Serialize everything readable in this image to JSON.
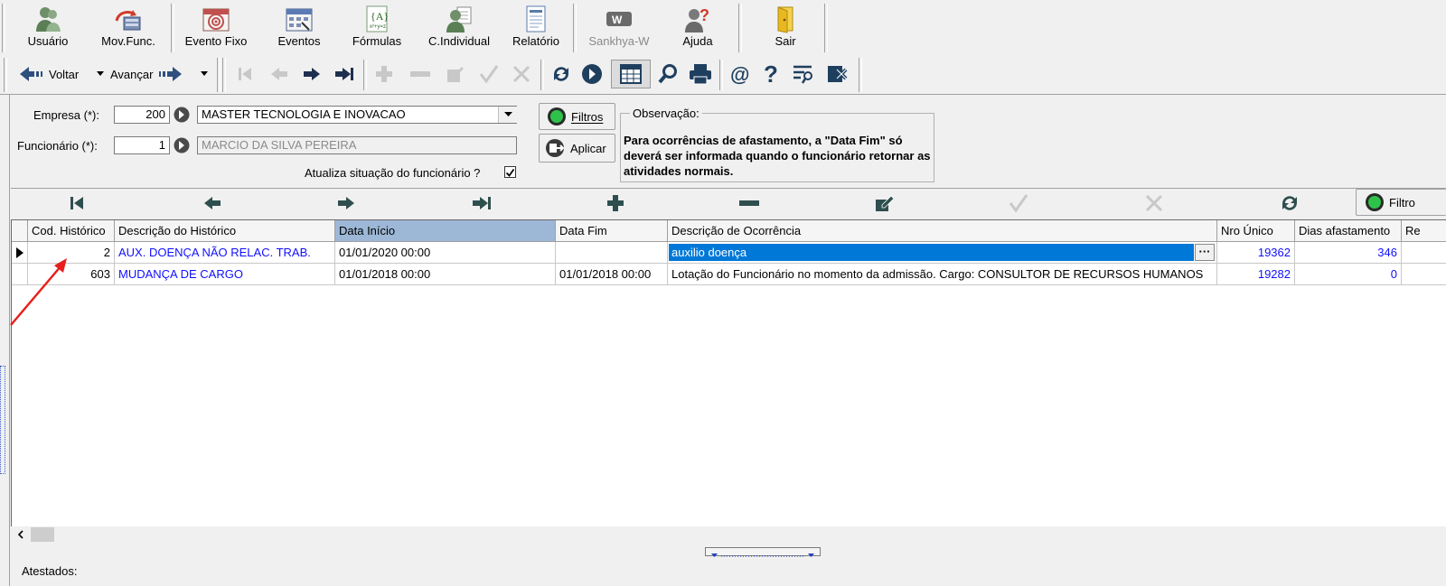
{
  "toolbar": {
    "items": [
      {
        "label": "Usuário",
        "icon": "users-icon"
      },
      {
        "label": "Mov.Func.",
        "icon": "employee-movement-icon"
      },
      {
        "label": "Evento Fixo",
        "icon": "calendar-target-icon"
      },
      {
        "label": "Eventos",
        "icon": "calendar-icon"
      },
      {
        "label": "Fórmulas",
        "icon": "formula-icon"
      },
      {
        "label": "C.Individual",
        "icon": "person-document-icon"
      },
      {
        "label": "Relatório",
        "icon": "report-icon"
      },
      {
        "label": "Sankhya-W",
        "icon": "sankhya-logo-icon"
      },
      {
        "label": "Ajuda",
        "icon": "help-person-icon"
      },
      {
        "label": "Sair",
        "icon": "exit-door-icon"
      }
    ]
  },
  "nav": {
    "back_label": "Voltar",
    "forward_label": "Avançar"
  },
  "form": {
    "empresa_label": "Empresa (*):",
    "empresa_code": "200",
    "empresa_name": "MASTER TECNOLOGIA E INOVACAO",
    "funcionario_label": "Funcionário (*):",
    "funcionario_code": "1",
    "funcionario_name": "MARCIO DA SILVA PEREIRA",
    "atualiza_label": "Atualiza situação do funcionário ?",
    "atualiza_checked": true,
    "filtros_label": "Filtros",
    "aplicar_label": "Aplicar",
    "observacao_title": "Observação:",
    "observacao_text": "Para ocorrências de afastamento, a \"Data Fim\" só deverá ser informada quando o funcionário retornar as atividades normais."
  },
  "grid": {
    "filtro_label": "Filtro",
    "columns": [
      "Cod. Histórico",
      "Descrição do Histórico",
      "Data Início",
      "Data Fim",
      "Descrição de Ocorrência",
      "Nro Único",
      "Dias afastamento",
      "Re"
    ],
    "rows": [
      {
        "cod": "2",
        "historico": "AUX. DOENÇA NÃO RELAC. TRAB.",
        "inicio": "01/01/2020 00:00",
        "fim": "",
        "ocorrencia": "auxilio doença",
        "nro": "19362",
        "dias": "346"
      },
      {
        "cod": "603",
        "historico": "MUDANÇA DE CARGO",
        "inicio": "01/01/2018 00:00",
        "fim": "01/01/2018 00:00",
        "ocorrencia": "Lotação do Funcionário no momento da admissão. Cargo: CONSULTOR DE RECURSOS HUMANOS",
        "nro": "19282",
        "dias": "0"
      }
    ],
    "ellipsis": "···"
  },
  "bottom": {
    "atestados_label": "Atestados:"
  },
  "colors": {
    "selection": "#0078d7",
    "link_blue": "#1010ff",
    "header_selected": "#9db7d6",
    "arrow_red": "#e8201c"
  }
}
